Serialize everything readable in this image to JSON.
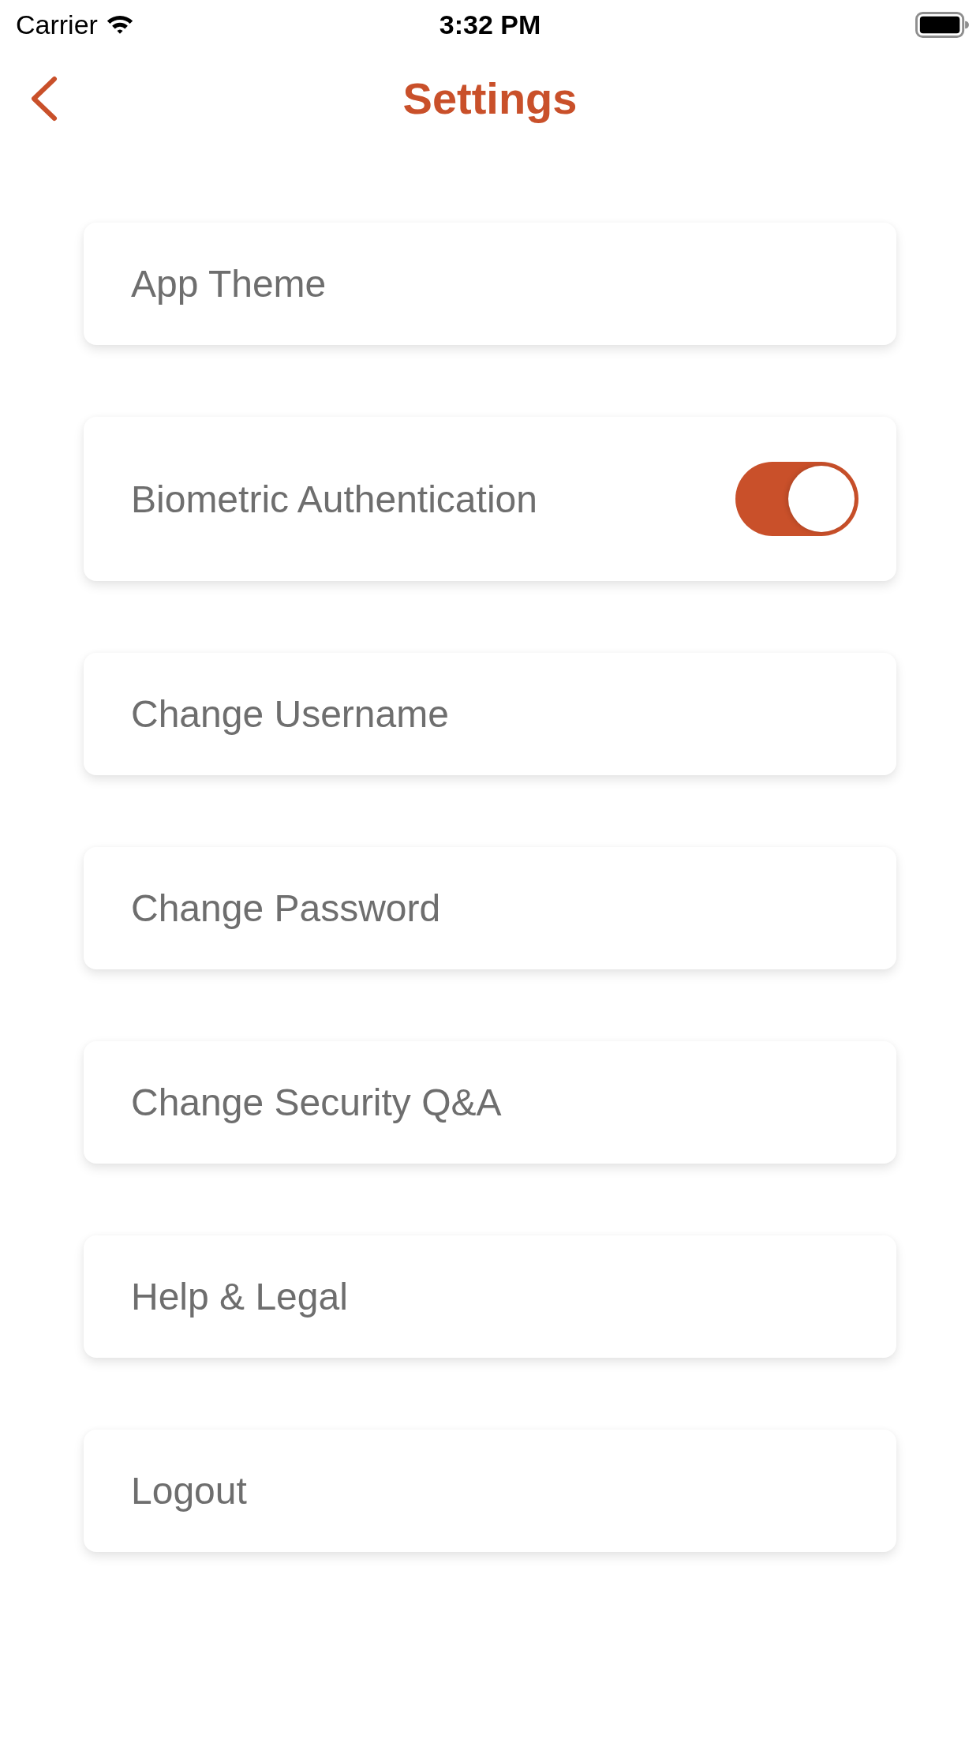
{
  "status_bar": {
    "carrier": "Carrier",
    "time": "3:32 PM"
  },
  "header": {
    "title": "Settings"
  },
  "items": [
    {
      "kind": "link",
      "label": "App Theme"
    },
    {
      "kind": "toggle",
      "label": "Biometric Authentication",
      "on": true
    },
    {
      "kind": "link",
      "label": "Change Username"
    },
    {
      "kind": "link",
      "label": "Change Password"
    },
    {
      "kind": "link",
      "label": "Change Security Q&A"
    },
    {
      "kind": "link",
      "label": "Help & Legal"
    },
    {
      "kind": "link",
      "label": "Logout"
    }
  ]
}
